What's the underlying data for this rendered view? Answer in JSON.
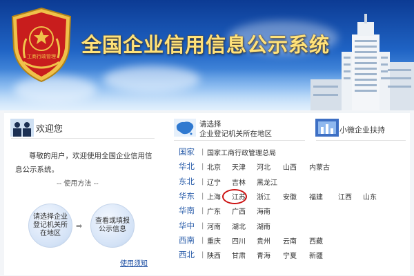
{
  "banner": {
    "title": "全国企业信用信息公示系统",
    "emblem_text": "工商行政管理"
  },
  "welcome": {
    "title": "欢迎您",
    "text": "尊敬的用户，欢迎使用全国企业信用信息公示系统。",
    "method": "-- 使用方法 --",
    "step1": "请选择企业登记机关所在地区",
    "step2": "查看或填报公示信息",
    "usage_link": "使用须知"
  },
  "select": {
    "line1": "请选择",
    "line2": "企业登记机关所在地区"
  },
  "small_business": {
    "title": "小微企业扶持"
  },
  "regions": [
    {
      "name": "国家",
      "provinces": [
        "国家工商行政管理总局"
      ]
    },
    {
      "name": "华北",
      "provinces": [
        "北京",
        "天津",
        "河北",
        "山西",
        "内蒙古"
      ]
    },
    {
      "name": "东北",
      "provinces": [
        "辽宁",
        "吉林",
        "黑龙江"
      ]
    },
    {
      "name": "华东",
      "provinces": [
        "上海",
        "江苏",
        "浙江",
        "安徽",
        "福建",
        "江西",
        "山东"
      ]
    },
    {
      "name": "华南",
      "provinces": [
        "广东",
        "广西",
        "海南"
      ]
    },
    {
      "name": "华中",
      "provinces": [
        "河南",
        "湖北",
        "湖南"
      ]
    },
    {
      "name": "西南",
      "provinces": [
        "重庆",
        "四川",
        "贵州",
        "云南",
        "西藏"
      ]
    },
    {
      "name": "西北",
      "provinces": [
        "陕西",
        "甘肃",
        "青海",
        "宁夏",
        "新疆"
      ]
    }
  ],
  "highlighted_province": "江苏",
  "colors": {
    "title_gold": "#ffe27a",
    "region_blue": "#2a5daa",
    "highlight_red": "#cc1111"
  }
}
